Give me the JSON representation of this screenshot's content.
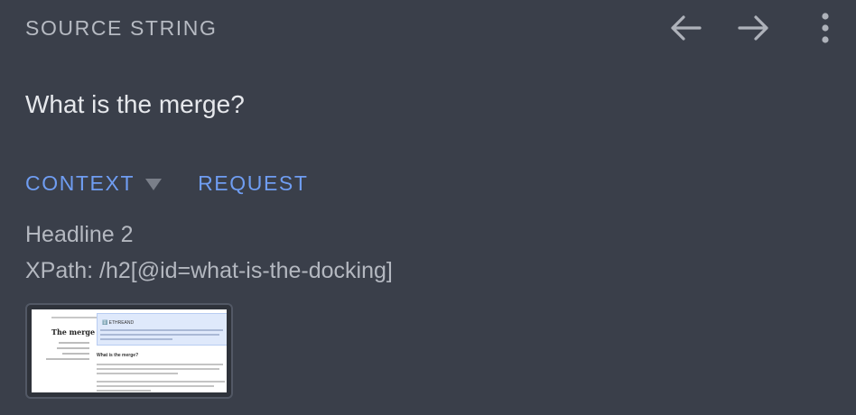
{
  "header": {
    "section_label": "SOURCE STRING",
    "icons": {
      "back": "arrow-left-icon",
      "forward": "arrow-right-icon",
      "more": "more-vertical-icon"
    }
  },
  "source": {
    "text": "What is the merge?"
  },
  "tabs": [
    {
      "label": "CONTEXT",
      "has_dropdown": true,
      "selected": true
    },
    {
      "label": "REQUEST",
      "has_dropdown": false,
      "selected": false
    }
  ],
  "context": {
    "element_type": "Headline 2",
    "xpath": "XPath: /h2[@id=what-is-the-docking]"
  },
  "screenshot_thumbnail": {
    "page_title": "The merge",
    "banner_title": "ℹ️ ETHREAND"
  },
  "colors": {
    "background": "#3a3f4a",
    "accent": "#6f9df2",
    "label": "#b6bac2",
    "text": "#e6e8ec"
  }
}
